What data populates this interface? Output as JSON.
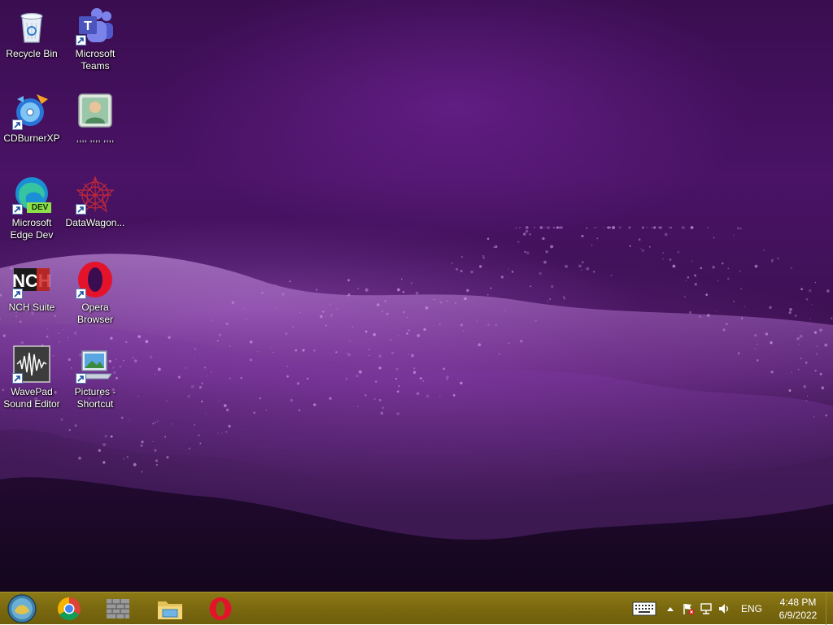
{
  "desktop": {
    "icons": [
      {
        "label": "Recycle Bin",
        "icon": "recycle-bin-icon"
      },
      {
        "label": "Microsoft\nTeams",
        "icon": "microsoft-teams-icon"
      },
      {
        "label": "CDBurnerXP",
        "icon": "cdburnerxp-icon"
      },
      {
        "label": ",,,, ,,,, ,,,,",
        "icon": "user-contact-icon"
      },
      {
        "label": "Microsoft\nEdge Dev",
        "icon": "edge-dev-icon"
      },
      {
        "label": "DataWagon...",
        "icon": "datawagon-icon"
      },
      {
        "label": "NCH Suite",
        "icon": "nch-suite-icon"
      },
      {
        "label": "Opera\nBrowser",
        "icon": "opera-icon"
      },
      {
        "label": "WavePad\nSound Editor",
        "icon": "wavepad-icon"
      },
      {
        "label": "Pictures -\nShortcut",
        "icon": "pictures-shortcut-icon"
      }
    ],
    "edge_badge": "DEV"
  },
  "taskbar": {
    "start": {
      "icon": "start-orb-icon"
    },
    "pinned": [
      {
        "icon": "chrome-icon"
      },
      {
        "icon": "wall-app-icon"
      },
      {
        "icon": "file-explorer-icon"
      },
      {
        "icon": "opera-icon"
      }
    ],
    "tray": {
      "keyboard_icon": "touch-keyboard-icon",
      "chevron_icon": "show-hidden-icons-chevron",
      "flag_icon": "action-center-flag-icon",
      "network_icon": "network-icon",
      "volume_icon": "volume-icon",
      "language": "ENG",
      "time": "4:48 PM",
      "date": "6/9/2022"
    }
  },
  "colors": {
    "taskbar": "#7c6a10",
    "desktop_bg": "#3a0d50",
    "particles": "#c88de6"
  }
}
